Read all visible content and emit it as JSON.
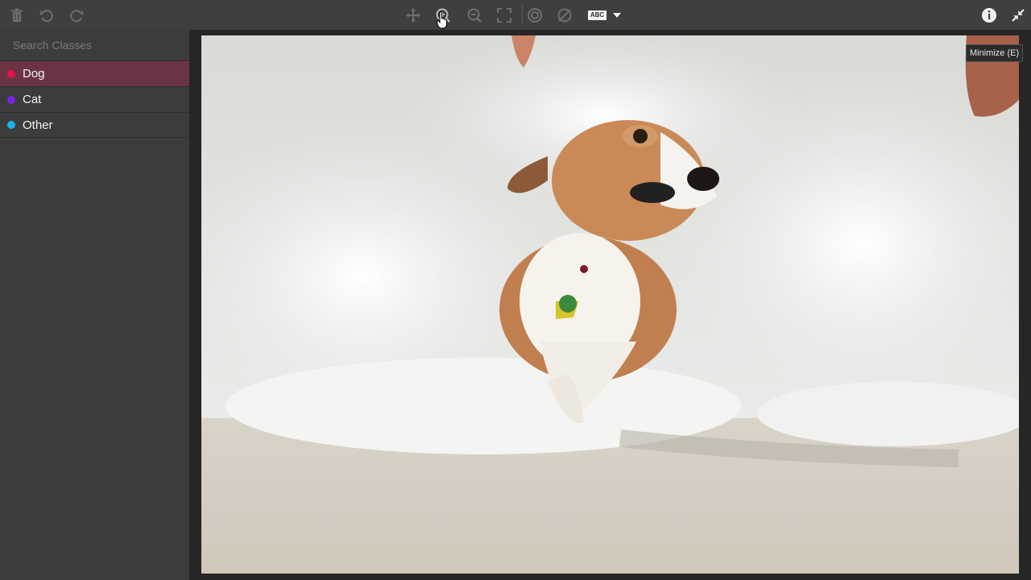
{
  "toolbar": {
    "left_icons": [
      "trash-icon",
      "undo-icon",
      "redo-icon"
    ],
    "center_icons": [
      "move-icon",
      "zoom-in-icon",
      "zoom-out-icon",
      "fit-screen-icon",
      "target-icon",
      "hide-icon"
    ],
    "label_toggle_text": "ABC",
    "right_icons": [
      "info-icon",
      "minimize-icon"
    ]
  },
  "sidebar": {
    "search_placeholder": "Search Classes",
    "classes": [
      {
        "label": "Dog",
        "color": "#e0144c",
        "selected": true
      },
      {
        "label": "Cat",
        "color": "#7b1fe0",
        "selected": false
      },
      {
        "label": "Other",
        "color": "#18b4e8",
        "selected": false
      }
    ]
  },
  "tooltip": {
    "text": "Minimize (E)"
  },
  "colors": {
    "selected_row": "#6b3444",
    "toolbar_bg": "#3f3f3f",
    "sidebar_bg": "#3c3c3c",
    "canvas_bg": "#262626"
  }
}
